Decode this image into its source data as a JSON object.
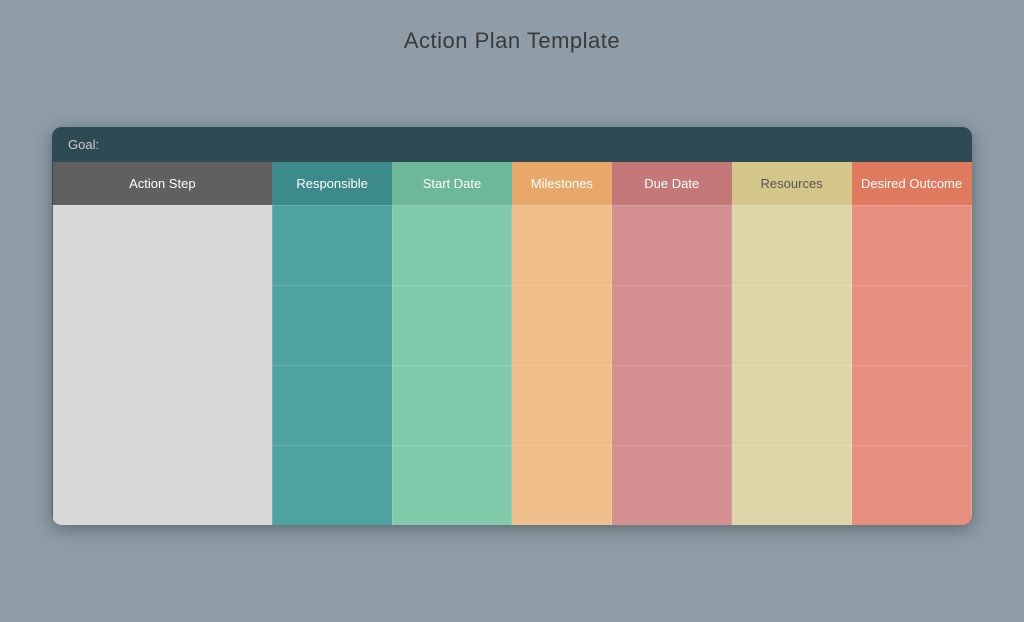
{
  "title": "Action Plan Template",
  "goal_label": "Goal:",
  "columns": [
    {
      "key": "action",
      "label": "Action Step",
      "class": "col-action"
    },
    {
      "key": "resp",
      "label": "Responsible",
      "class": "col-resp"
    },
    {
      "key": "start",
      "label": "Start Date",
      "class": "col-start"
    },
    {
      "key": "mile",
      "label": "Milestones",
      "class": "col-mile"
    },
    {
      "key": "due",
      "label": "Due Date",
      "class": "col-due"
    },
    {
      "key": "res",
      "label": "Resources",
      "class": "col-res"
    },
    {
      "key": "desired",
      "label": "Desired Outcome",
      "class": "col-desired"
    }
  ],
  "rows": 4
}
